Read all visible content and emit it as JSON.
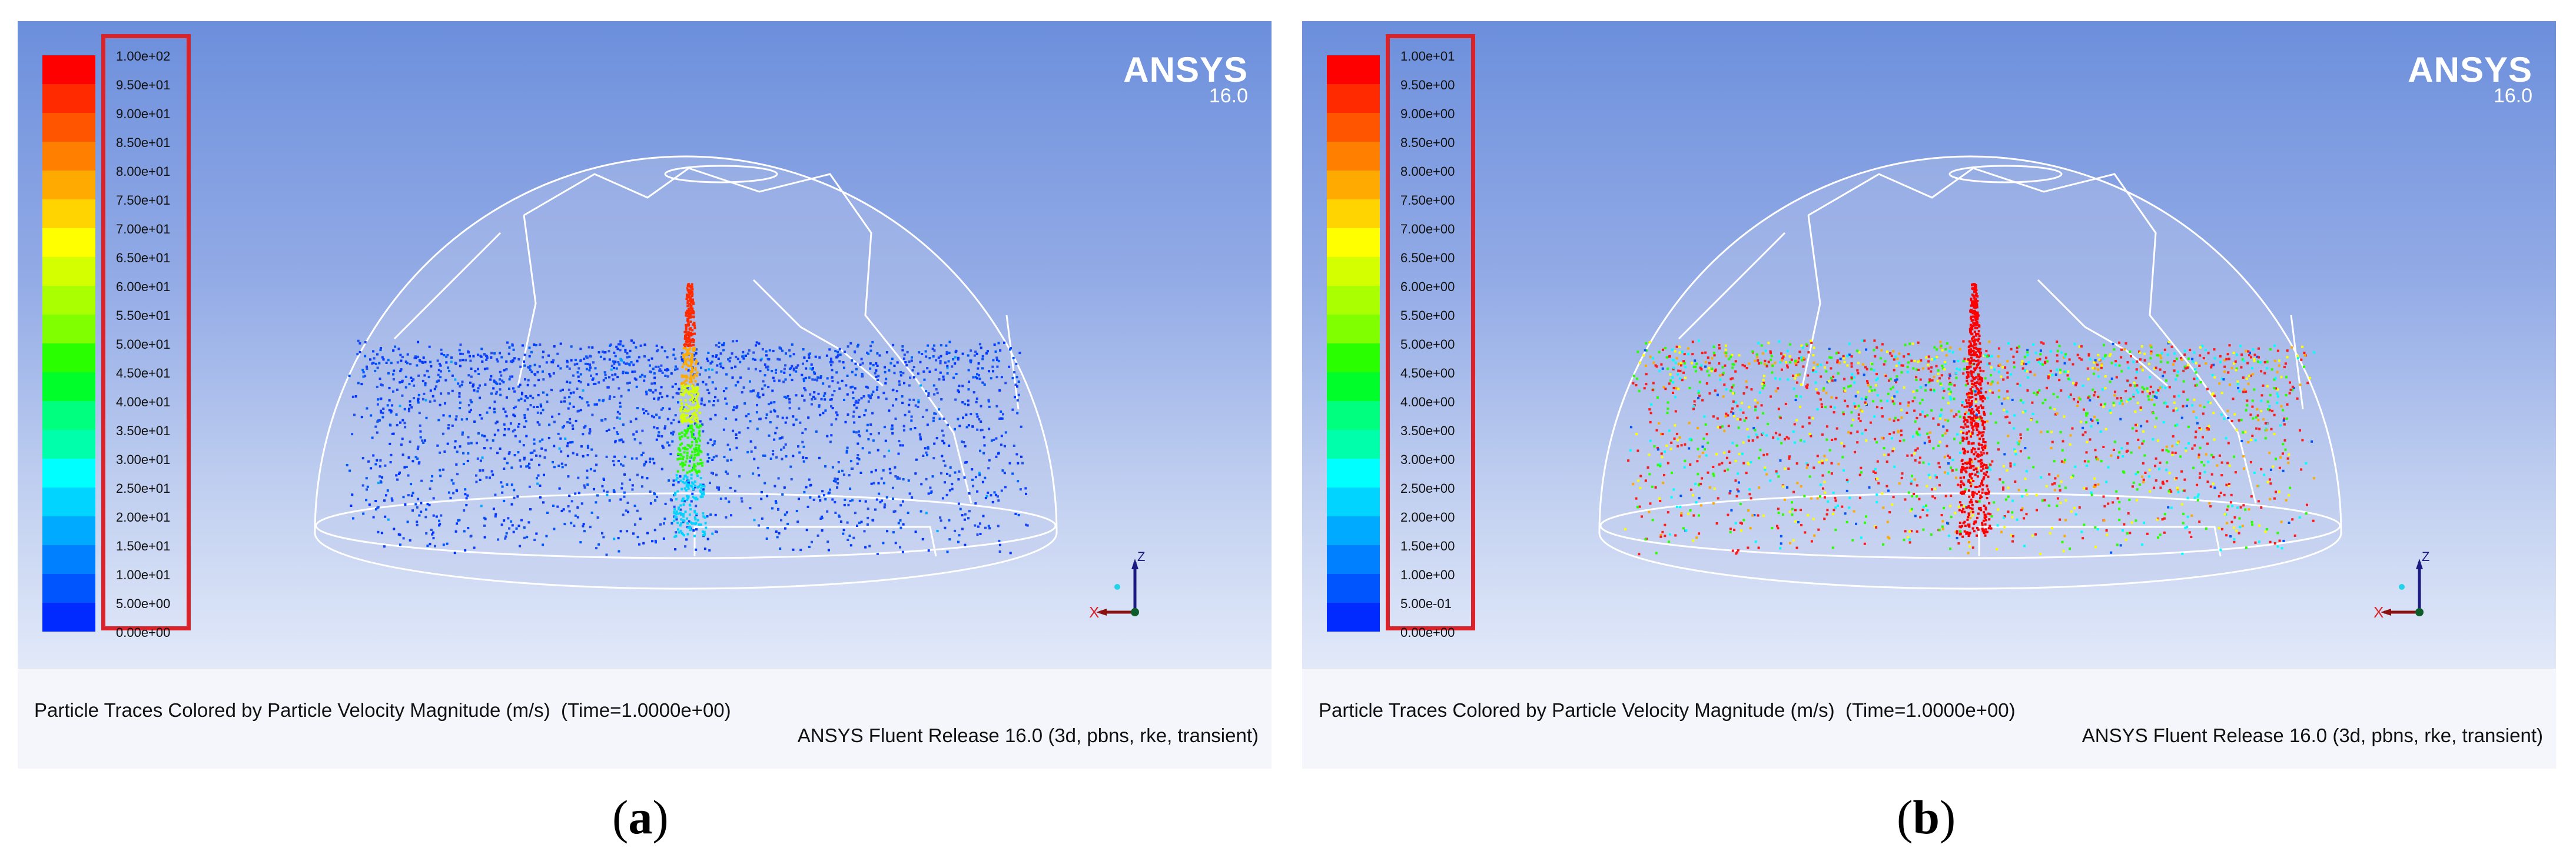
{
  "panels": [
    {
      "id": "a",
      "label_open": "(",
      "label_letter": "a",
      "label_close": ")",
      "logo": {
        "brand": "ANSYS",
        "version": "16.0"
      },
      "colorbar_ticks": [
        "1.00e+02",
        "9.50e+01",
        "9.00e+01",
        "8.50e+01",
        "8.00e+01",
        "7.50e+01",
        "7.00e+01",
        "6.50e+01",
        "6.00e+01",
        "5.50e+01",
        "5.00e+01",
        "4.50e+01",
        "4.00e+01",
        "3.50e+01",
        "3.00e+01",
        "2.50e+01",
        "2.00e+01",
        "1.50e+01",
        "1.00e+01",
        "5.00e+00",
        "0.00e+00"
      ],
      "caption_title": "Particle Traces Colored by Particle Velocity Magnitude (m/s)  (Time=1.0000e+00)",
      "caption_release": "ANSYS Fluent Release 16.0 (3d, pbns, rke, transient)",
      "triad": {
        "x_label": "X",
        "z_label": "Z"
      }
    },
    {
      "id": "b",
      "label_open": "(",
      "label_letter": "b",
      "label_close": ")",
      "logo": {
        "brand": "ANSYS",
        "version": "16.0"
      },
      "colorbar_ticks": [
        "1.00e+01",
        "9.50e+00",
        "9.00e+00",
        "8.50e+00",
        "8.00e+00",
        "7.50e+00",
        "7.00e+00",
        "6.50e+00",
        "6.00e+00",
        "5.50e+00",
        "5.00e+00",
        "4.50e+00",
        "4.00e+00",
        "3.50e+00",
        "3.00e+00",
        "2.50e+00",
        "2.00e+00",
        "1.50e+00",
        "1.00e+00",
        "5.00e-01",
        "0.00e+00"
      ],
      "caption_title": "Particle Traces Colored by Particle Velocity Magnitude (m/s)  (Time=1.0000e+00)",
      "caption_release": "ANSYS Fluent Release 16.0 (3d, pbns, rke, transient)",
      "triad": {
        "x_label": "X",
        "z_label": "Z"
      }
    }
  ],
  "colors": {
    "colormap": [
      "#ff0000",
      "#ff2a00",
      "#ff5500",
      "#ff7f00",
      "#ffaa00",
      "#ffd400",
      "#ffff00",
      "#d4ff00",
      "#aaff00",
      "#7fff00",
      "#2aff00",
      "#00ff2a",
      "#00ff7f",
      "#00ffaa",
      "#00ffff",
      "#00d4ff",
      "#00aaff",
      "#007fff",
      "#0055ff",
      "#002aff"
    ],
    "highlight_box": "#d9232a",
    "background_top": "#6c8fdc",
    "background_bottom": "#e2e9f9"
  }
}
